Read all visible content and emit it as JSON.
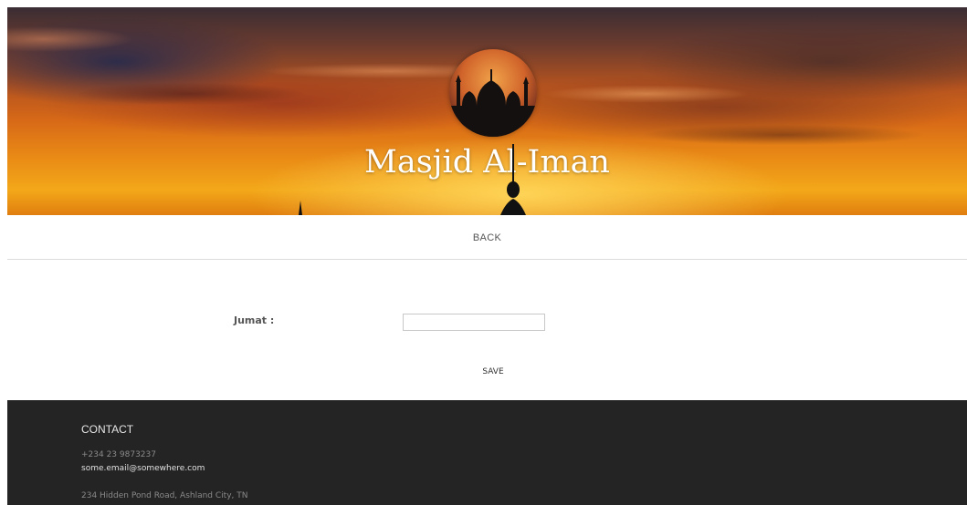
{
  "header": {
    "site_title": "Masjid Al-Iman"
  },
  "nav": {
    "back_label": "BACK"
  },
  "form": {
    "jumat_label": "Jumat :",
    "jumat_value": "",
    "save_label": "SAVE"
  },
  "footer": {
    "heading": "CONTACT",
    "phone": "+234 23 9873237",
    "email": "some.email@somewhere.com",
    "address": "234 Hidden Pond Road, Ashland City, TN"
  },
  "colors": {
    "footer_bg": "#242424",
    "title_color": "#ffffff",
    "text_muted": "#555555"
  }
}
